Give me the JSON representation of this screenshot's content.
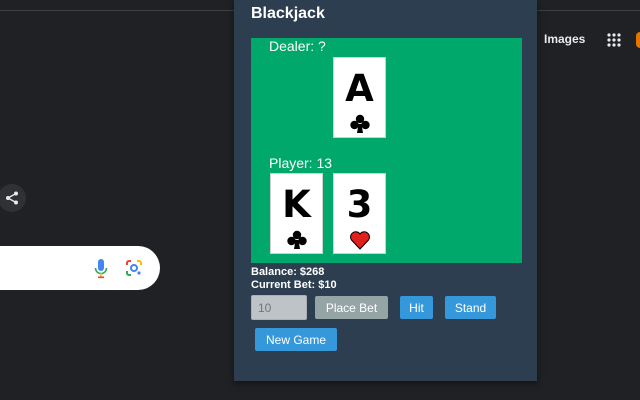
{
  "browser": {
    "images_link": "Images",
    "search_placeholder": ""
  },
  "popup": {
    "title": "Blackjack",
    "dealer_label": "Dealer: ?",
    "player_label": "Player: 13",
    "dealer_cards": [
      {
        "rank": "A",
        "suit": "clubs",
        "suit_color": "#000000"
      }
    ],
    "player_cards": [
      {
        "rank": "K",
        "suit": "clubs",
        "suit_color": "#000000"
      },
      {
        "rank": "3",
        "suit": "hearts",
        "suit_color": "#e0201b"
      }
    ],
    "balance": "Balance: $268",
    "current_bet": "Current Bet: $10",
    "bet_input_placeholder": "10",
    "bet_input_value": "",
    "buttons": {
      "place_bet": "Place Bet",
      "hit": "Hit",
      "stand": "Stand",
      "new_game": "New Game"
    }
  },
  "colors": {
    "popup_bg": "#2c3e50",
    "table_green": "#00a86b",
    "button_blue": "#3498db",
    "button_disabled": "#95a5a6"
  }
}
